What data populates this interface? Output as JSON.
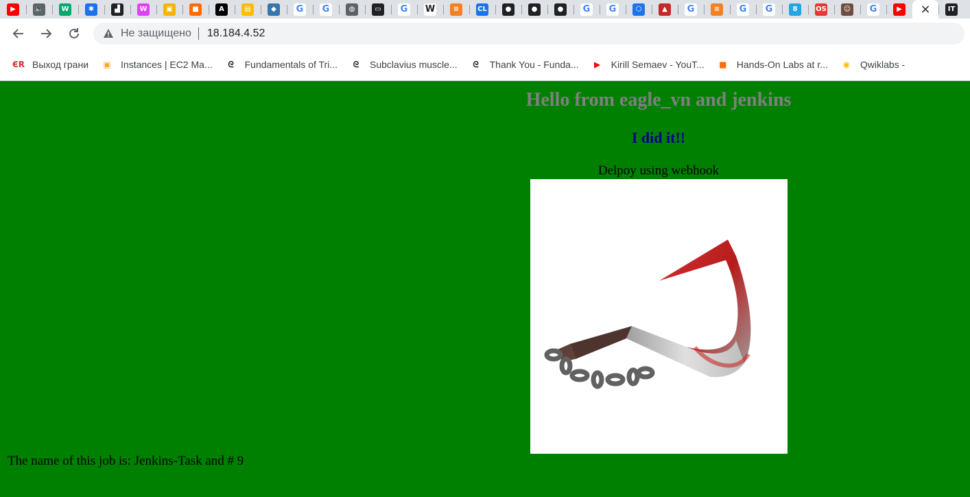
{
  "browser": {
    "tabs": [
      {
        "icon": "youtube-icon",
        "color": "#ff0000",
        "glyph": "▶"
      },
      {
        "icon": "speaker-icon",
        "color": "#5f6368",
        "glyph": "🔈"
      },
      {
        "icon": "w3schools-icon",
        "color": "#04aa6d",
        "glyph": "W"
      },
      {
        "icon": "app-icon",
        "color": "#1a73e8",
        "glyph": "✱"
      },
      {
        "icon": "bars-icon",
        "color": "#202124",
        "glyph": "▟"
      },
      {
        "icon": "w-italic-icon",
        "color": "#e040fb",
        "glyph": "W"
      },
      {
        "icon": "box-icon",
        "color": "#f4b400",
        "glyph": "▣"
      },
      {
        "icon": "cube-icon",
        "color": "#ff6d00",
        "glyph": "■"
      },
      {
        "icon": "ansible-icon",
        "color": "#000000",
        "glyph": "A"
      },
      {
        "icon": "book-icon",
        "color": "#fbbc04",
        "glyph": "▤"
      },
      {
        "icon": "python-icon",
        "color": "#3776ab",
        "glyph": "◆"
      },
      {
        "icon": "google-icon",
        "color": "#4285f4",
        "glyph": "G"
      },
      {
        "icon": "google-icon",
        "color": "#4285f4",
        "glyph": "G"
      },
      {
        "icon": "globe-icon",
        "color": "#5f6368",
        "glyph": "◍"
      },
      {
        "icon": "terminal-icon",
        "color": "#202124",
        "glyph": "▭"
      },
      {
        "icon": "google-icon",
        "color": "#4285f4",
        "glyph": "G"
      },
      {
        "icon": "wikipedia-icon",
        "color": "#202124",
        "glyph": "W"
      },
      {
        "icon": "stackoverflow-icon",
        "color": "#f48024",
        "glyph": "≡"
      },
      {
        "icon": "cl-icon",
        "color": "#1a73e8",
        "glyph": "CL"
      },
      {
        "icon": "github-icon",
        "color": "#202124",
        "glyph": "●"
      },
      {
        "icon": "github-icon",
        "color": "#202124",
        "glyph": "●"
      },
      {
        "icon": "github-icon",
        "color": "#202124",
        "glyph": "●"
      },
      {
        "icon": "google-icon",
        "color": "#4285f4",
        "glyph": "G"
      },
      {
        "icon": "google-icon",
        "color": "#4285f4",
        "glyph": "G"
      },
      {
        "icon": "hexagon-icon",
        "color": "#1a73e8",
        "glyph": "⬡"
      },
      {
        "icon": "triangle-icon",
        "color": "#c62828",
        "glyph": "▲"
      },
      {
        "icon": "google-icon",
        "color": "#4285f4",
        "glyph": "G"
      },
      {
        "icon": "stackoverflow-icon",
        "color": "#f48024",
        "glyph": "≡"
      },
      {
        "icon": "google-icon",
        "color": "#4285f4",
        "glyph": "G"
      },
      {
        "icon": "google-icon",
        "color": "#4285f4",
        "glyph": "G"
      },
      {
        "icon": "k8s-icon",
        "color": "#26a5e4",
        "glyph": "8"
      },
      {
        "icon": "os-icon",
        "color": "#e53935",
        "glyph": "OS"
      },
      {
        "icon": "jenkins-icon",
        "color": "#6d4c41",
        "glyph": "☺"
      },
      {
        "icon": "google-icon",
        "color": "#4285f4",
        "glyph": "G"
      },
      {
        "icon": "youtube-icon",
        "color": "#ff0000",
        "glyph": "▶"
      },
      {
        "icon": "close-icon",
        "color": "#202124",
        "glyph": "×",
        "active": true
      },
      {
        "icon": "itfb-icon",
        "color": "#202124",
        "glyph": "IT"
      }
    ],
    "address": {
      "security_text": "Не защищено",
      "url": "18.184.4.52"
    },
    "bookmarks": [
      {
        "label": "Выход грани",
        "icon": "er-icon",
        "color": "#d32f2f",
        "glyph": "ЄR"
      },
      {
        "label": "Instances | EC2 Ma...",
        "icon": "aws-box-icon",
        "color": "#f9a825",
        "glyph": "▣"
      },
      {
        "label": "Fundamentals of Tri...",
        "icon": "wave-icon",
        "color": "#202124",
        "glyph": "ᘓ"
      },
      {
        "label": "Subclavius muscle...",
        "icon": "wave-icon",
        "color": "#202124",
        "glyph": "ᘓ"
      },
      {
        "label": "Thank You - Funda...",
        "icon": "wave-icon",
        "color": "#202124",
        "glyph": "ᘓ"
      },
      {
        "label": "Kirill Semaev - YouT...",
        "icon": "youtube-icon",
        "color": "#ff0000",
        "glyph": "▶"
      },
      {
        "label": "Hands-On Labs at r...",
        "icon": "cube-icon",
        "color": "#ff6d00",
        "glyph": "■"
      },
      {
        "label": "Qwiklabs -",
        "icon": "qwiklabs-icon",
        "color": "#fbbc04",
        "glyph": "◉"
      }
    ]
  },
  "page": {
    "background": "#008000",
    "heading": "Hello from eagle_vn and jenkins",
    "subheading": "I did it!!",
    "caption": "Delpoy using webhook",
    "job_text": "The name of this job is: Jenkins-Task and # 9"
  }
}
